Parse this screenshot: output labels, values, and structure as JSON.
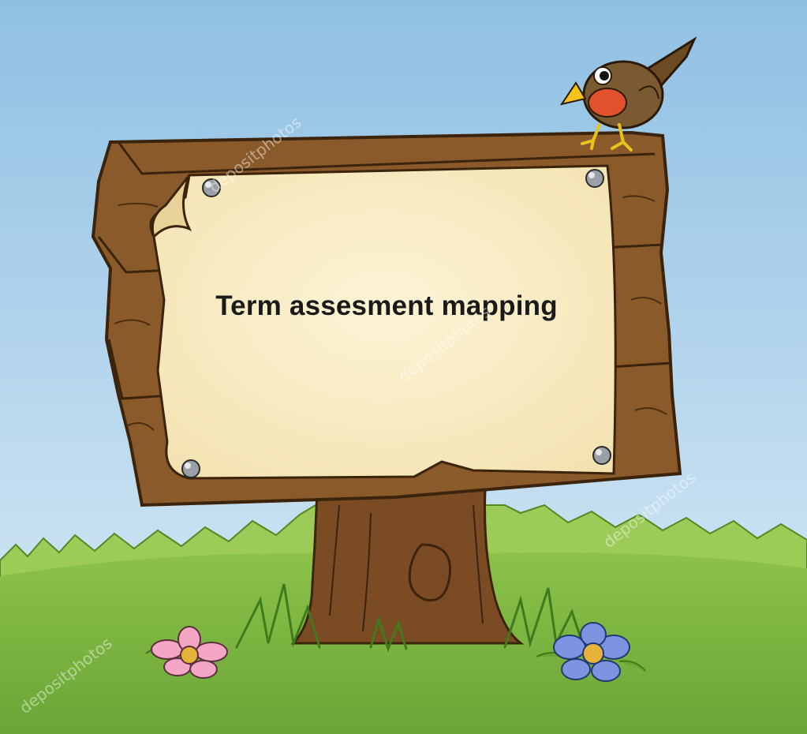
{
  "sign": {
    "text": "Term assesment mapping"
  },
  "watermark": {
    "text": "depositphotos"
  },
  "colors": {
    "sky_top": "#8fc0e4",
    "sky_bottom": "#dcecf6",
    "grass": "#7cb342",
    "grass_dark": "#4f8a22",
    "wood": "#8b5a2b",
    "wood_dark": "#5b3716",
    "paper": "#fbefc8",
    "bird_body": "#7a5a30",
    "bird_breast": "#e2502c",
    "beak": "#f4c41c",
    "flower_pink": "#f4a6c4",
    "flower_blue": "#7d95e0",
    "flower_center": "#e6b33a"
  }
}
